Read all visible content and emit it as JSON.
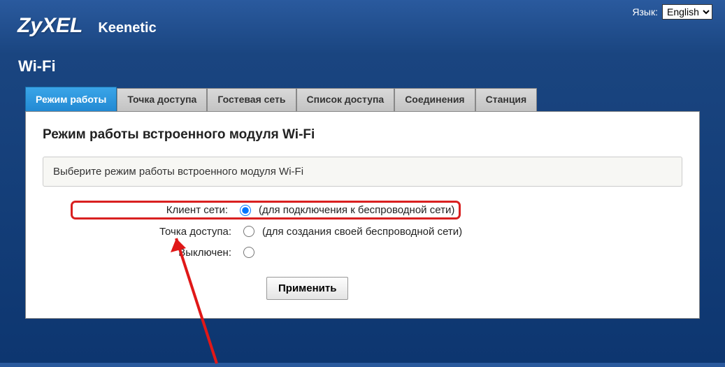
{
  "language": {
    "label": "Язык:",
    "selected": "English"
  },
  "brand": "ZyXEL",
  "product": "Keenetic",
  "page_title": "Wi-Fi",
  "tabs": [
    {
      "label": "Режим работы",
      "active": true
    },
    {
      "label": "Точка доступа",
      "active": false
    },
    {
      "label": "Гостевая сеть",
      "active": false
    },
    {
      "label": "Список доступа",
      "active": false
    },
    {
      "label": "Соединения",
      "active": false
    },
    {
      "label": "Станция",
      "active": false
    }
  ],
  "section_heading": "Режим работы встроенного модуля Wi-Fi",
  "instruction": "Выберите режим работы встроенного модуля Wi-Fi",
  "options": {
    "client": {
      "label": "Клиент сети:",
      "description": "(для подключения к беспроводной сети)",
      "checked": true
    },
    "ap": {
      "label": "Точка доступа:",
      "description": "(для создания своей беспроводной сети)",
      "checked": false
    },
    "off": {
      "label": "Выключен:",
      "description": "",
      "checked": false
    }
  },
  "apply_label": "Применить"
}
